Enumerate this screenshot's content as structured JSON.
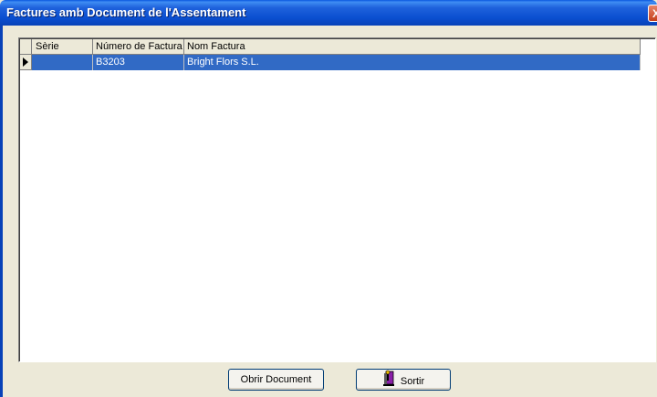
{
  "window": {
    "title": "Factures amb Document de l'Assentament",
    "close_glyph": "X"
  },
  "grid": {
    "columns": [
      "Sèrie",
      "Número de Factura",
      "Nom Factura"
    ],
    "rows": [
      {
        "serie": "",
        "numero": "B3203",
        "nom": "Bright Flors S.L."
      }
    ],
    "selected_row_index": 0,
    "selection_color": "#316ac5"
  },
  "buttons": {
    "open_document": "Obrir Document",
    "exit": "Sortir",
    "exit_icon": "door-exit-icon"
  },
  "colors": {
    "titlebar": "#0a4fd0",
    "background": "#ece9d8"
  }
}
